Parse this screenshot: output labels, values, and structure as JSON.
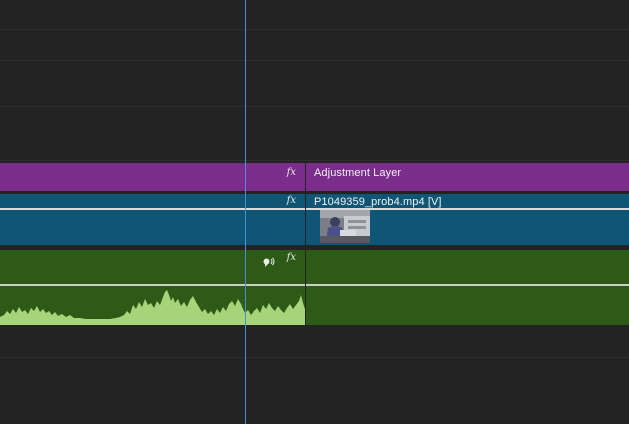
{
  "timeline": {
    "clips": {
      "adjustment_label": "Adjustment Layer",
      "video_label": "P1049359_prob4.mp4 [V]",
      "fx_label": "fx"
    },
    "colors": {
      "adjustment": "#7a2d8a",
      "video": "#0f5575",
      "audio": "#2e5a18",
      "waveform": "#a7d478",
      "playhead": "#4a8fd6"
    },
    "icons": {
      "fx": "fx-badge-icon",
      "voice": "voice-speaker-icon",
      "thumbnail": "video-thumbnail-icon"
    }
  }
}
